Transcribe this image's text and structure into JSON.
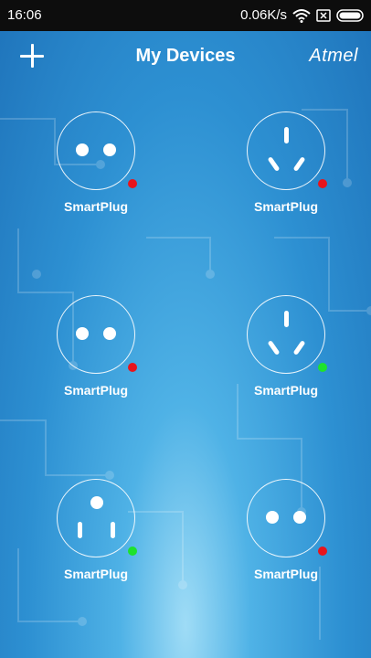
{
  "statusbar": {
    "time": "16:06",
    "net_speed": "0.06K/s",
    "icons": [
      "wifi-icon",
      "sim-off-icon",
      "battery-icon"
    ]
  },
  "header": {
    "title": "My Devices",
    "brand": "Atmel",
    "add_icon": "plus-icon"
  },
  "devices": [
    {
      "label": "SmartPlug",
      "plug_type": "two-round-pin",
      "status": "offline"
    },
    {
      "label": "SmartPlug",
      "plug_type": "three-flat-pin",
      "status": "offline"
    },
    {
      "label": "SmartPlug",
      "plug_type": "two-round-pin",
      "status": "offline"
    },
    {
      "label": "SmartPlug",
      "plug_type": "three-flat-pin",
      "status": "online"
    },
    {
      "label": "SmartPlug",
      "plug_type": "us-grounded",
      "status": "online"
    },
    {
      "label": "SmartPlug",
      "plug_type": "two-round-pin",
      "status": "offline"
    }
  ],
  "colors": {
    "offline": "#e8141c",
    "online": "#1ee22c",
    "statusbar": "#0d0d0d",
    "background": "#2d90d2"
  }
}
